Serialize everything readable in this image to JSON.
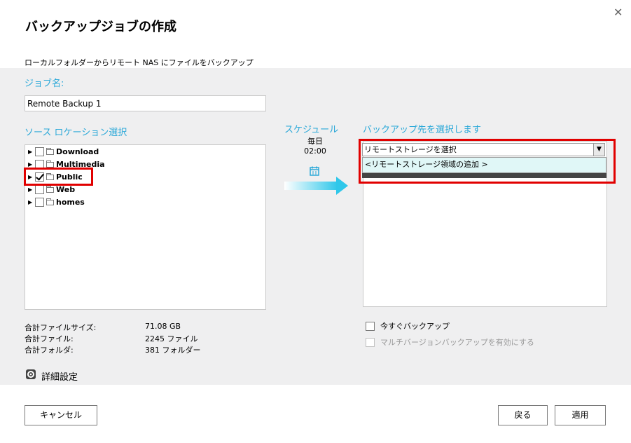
{
  "dialog": {
    "title": "バックアップジョブの作成",
    "description": "ローカルフォルダーからリモート NAS にファイルをバックアップ"
  },
  "job_name": {
    "label": "ジョブ名:",
    "value": "Remote Backup 1"
  },
  "source": {
    "label": "ソース ロケーション選択",
    "folders": [
      {
        "name": "Download",
        "checked": false
      },
      {
        "name": "Multimedia",
        "checked": false
      },
      {
        "name": "Public",
        "checked": true
      },
      {
        "name": "Web",
        "checked": false
      },
      {
        "name": "homes",
        "checked": false
      }
    ]
  },
  "stats": {
    "total_size_label": "合計ファイルサイズ:",
    "total_size_value": "71.08 GB",
    "total_files_label": "合計ファイル:",
    "total_files_value": "2245 ファイル",
    "total_folders_label": "合計フォルダ:",
    "total_folders_value": "381 フォルダー"
  },
  "advanced": {
    "label": "詳細設定",
    "icon": "gear-icon"
  },
  "schedule": {
    "label": "スケジュール",
    "frequency": "毎日",
    "time": "02:00",
    "icon": "calendar-icon"
  },
  "destination": {
    "label": "バックアップ先を選択します",
    "select_value": "リモートストレージを選択",
    "dropdown_option": "<リモートストレージ領域の追加 >"
  },
  "options": {
    "backup_now": "今すぐバックアップ",
    "multi_version": "マルチバージョンバックアップを有効にする"
  },
  "buttons": {
    "cancel": "キャンセル",
    "back": "戻る",
    "apply": "適用"
  },
  "colors": {
    "accent": "#2aa8d8",
    "highlight": "#e10000",
    "arrow": "#2fc7ea"
  }
}
